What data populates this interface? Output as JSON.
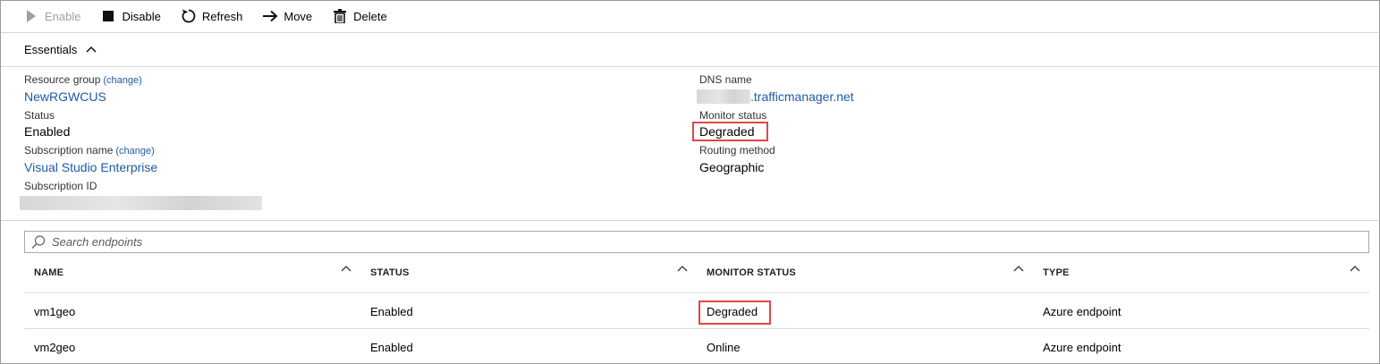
{
  "toolbar": {
    "enable": "Enable",
    "disable": "Disable",
    "refresh": "Refresh",
    "move": "Move",
    "delete": "Delete"
  },
  "essentials": {
    "title": "Essentials",
    "resource_group_label": "Resource group",
    "resource_group_change": "(change)",
    "resource_group_value": "NewRGWCUS",
    "status_label": "Status",
    "status_value": "Enabled",
    "subscription_name_label": "Subscription name",
    "subscription_name_change": "(change)",
    "subscription_name_value": "Visual Studio Enterprise",
    "subscription_id_label": "Subscription ID",
    "dns_name_label": "DNS name",
    "dns_name_suffix": ".trafficmanager.net",
    "monitor_status_label": "Monitor status",
    "monitor_status_value": "Degraded",
    "routing_method_label": "Routing method",
    "routing_method_value": "Geographic"
  },
  "search": {
    "placeholder": "Search endpoints"
  },
  "table": {
    "columns": [
      "NAME",
      "STATUS",
      "MONITOR STATUS",
      "TYPE"
    ],
    "rows": [
      [
        "vm1geo",
        "Enabled",
        "Degraded",
        "Azure endpoint"
      ],
      [
        "vm2geo",
        "Enabled",
        "Online",
        "Azure endpoint"
      ]
    ]
  },
  "colors": {
    "link": "#1f5aa8",
    "highlight_box": "#e04848",
    "disabled_text": "#a0a0a0"
  },
  "icons": {
    "enable": "play-icon",
    "disable": "stop-icon",
    "refresh": "refresh-icon",
    "move": "arrow-right-icon",
    "delete": "trash-icon",
    "essentials_toggle": "chevron-up-icon",
    "search": "search-icon",
    "sort": "sort-up-icon"
  }
}
